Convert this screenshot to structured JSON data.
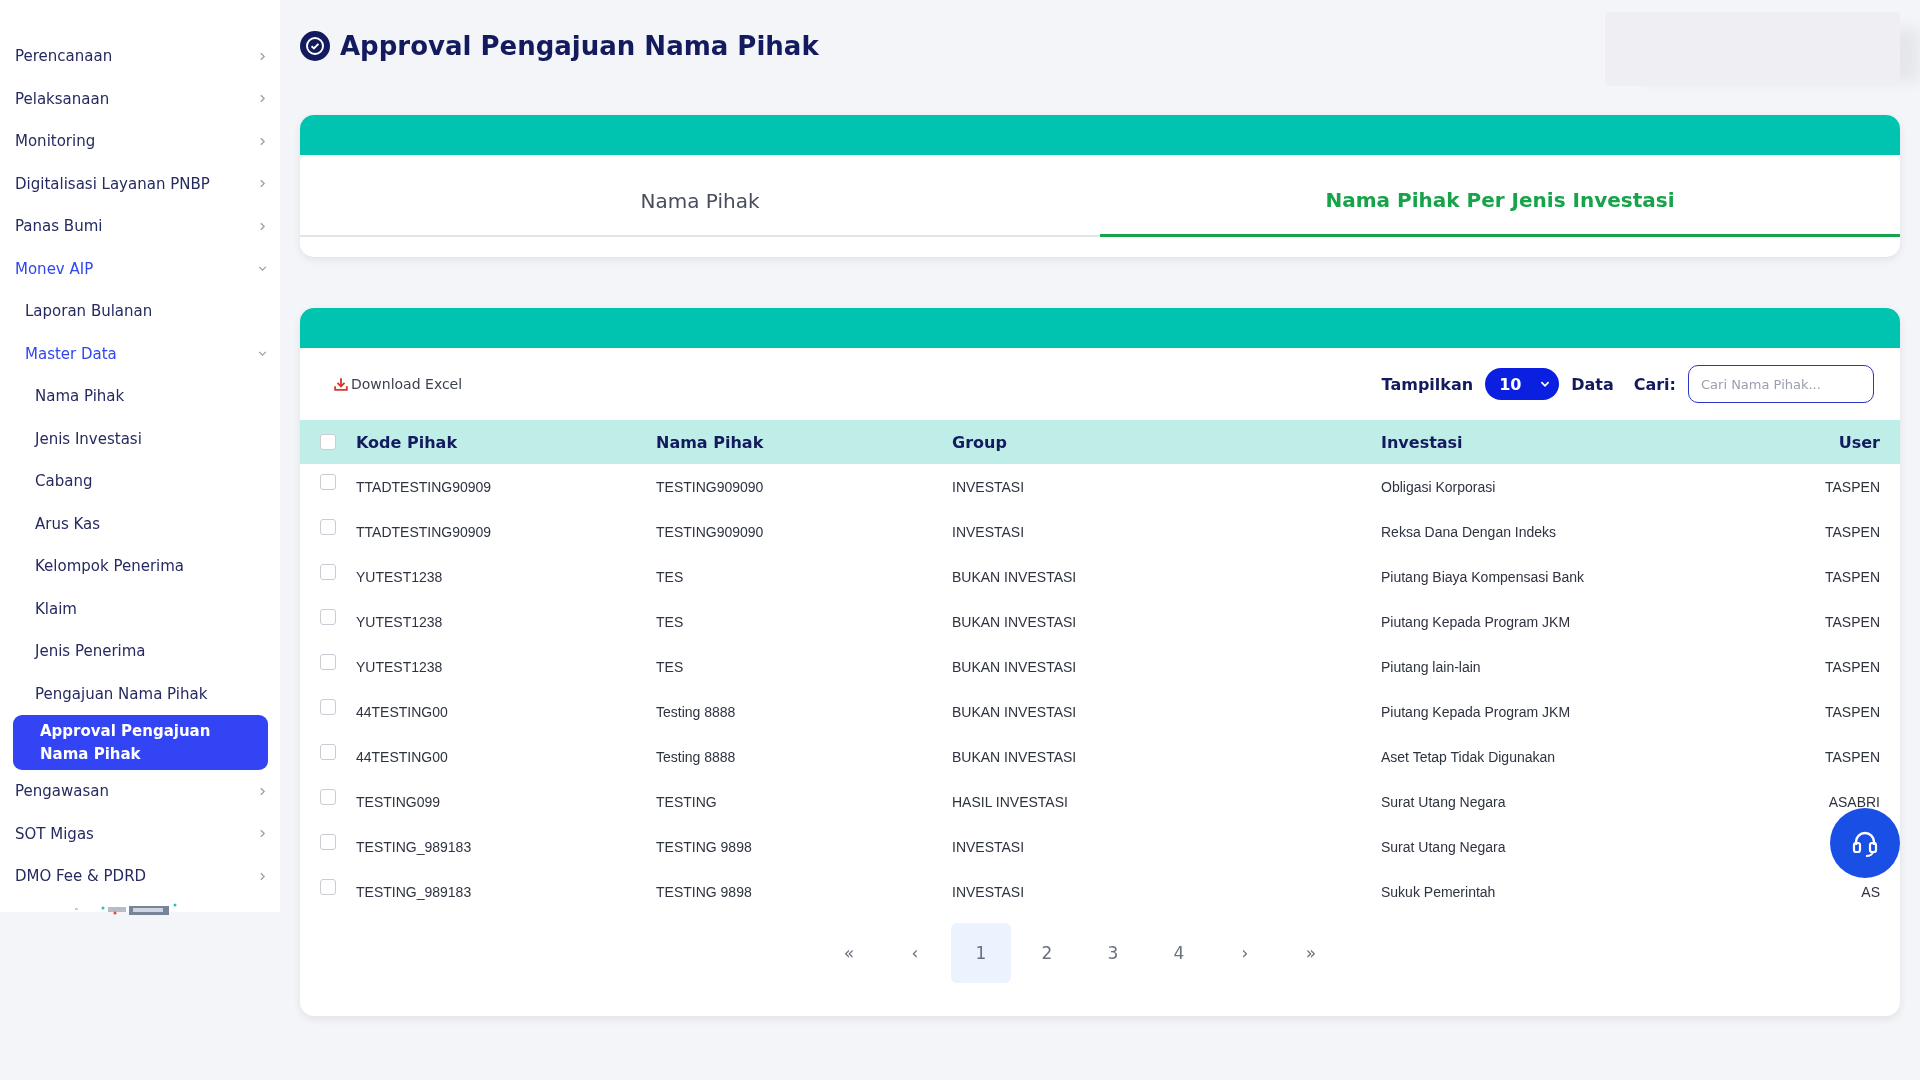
{
  "sidebar": {
    "items": [
      {
        "label": "Perencanaan",
        "expanded": false,
        "selected": false
      },
      {
        "label": "Pelaksanaan",
        "expanded": false,
        "selected": false
      },
      {
        "label": "Monitoring",
        "expanded": false,
        "selected": false
      },
      {
        "label": "Digitalisasi Layanan PNBP",
        "expanded": false,
        "selected": false
      },
      {
        "label": "Panas Bumi",
        "expanded": false,
        "selected": false
      },
      {
        "label": "Monev AIP",
        "expanded": true,
        "selected": false,
        "children": [
          {
            "label": "Laporan Bulanan",
            "selected": false
          },
          {
            "label": "Master Data",
            "expanded": true,
            "selected": false,
            "children": [
              {
                "label": "Nama Pihak",
                "selected": false
              },
              {
                "label": "Jenis Investasi",
                "selected": false
              },
              {
                "label": "Cabang",
                "selected": false
              },
              {
                "label": "Arus Kas",
                "selected": false
              },
              {
                "label": "Kelompok Penerima",
                "selected": false
              },
              {
                "label": "Klaim",
                "selected": false
              },
              {
                "label": "Jenis Penerima",
                "selected": false
              },
              {
                "label": "Pengajuan Nama Pihak",
                "selected": false
              },
              {
                "label": "Approval Pengajuan Nama Pihak",
                "selected": true
              }
            ]
          }
        ]
      },
      {
        "label": "Pengawasan",
        "expanded": false,
        "selected": false
      },
      {
        "label": "SOT Migas",
        "expanded": false,
        "selected": false
      },
      {
        "label": "DMO Fee & PDRD",
        "expanded": false,
        "selected": false
      }
    ]
  },
  "page": {
    "title": "Approval Pengajuan Nama Pihak"
  },
  "tabs": [
    {
      "label": "Nama Pihak",
      "selected": false
    },
    {
      "label": "Nama Pihak Per Jenis Investasi",
      "selected": true
    }
  ],
  "toolbar": {
    "download": "Download Excel",
    "show_label": "Tampilkan",
    "page_size": "10",
    "data_label": "Data",
    "search_label": "Cari:",
    "search": {
      "placeholder": "Cari Nama Pihak..."
    }
  },
  "table": {
    "select_all": {
      "checked": false
    },
    "columns": [
      "Kode Pihak",
      "Nama Pihak",
      "Group",
      "Investasi",
      "User"
    ],
    "rows": [
      {
        "checked": false,
        "cells": [
          "TTADTESTING90909",
          "TESTING909090",
          "INVESTASI",
          "Obligasi Korporasi",
          "TASPEN"
        ]
      },
      {
        "checked": false,
        "cells": [
          "TTADTESTING90909",
          "TESTING909090",
          "INVESTASI",
          "Reksa Dana Dengan Indeks",
          "TASPEN"
        ]
      },
      {
        "checked": false,
        "cells": [
          "YUTEST1238",
          "TES",
          "BUKAN INVESTASI",
          "Piutang Biaya Kompensasi Bank",
          "TASPEN"
        ]
      },
      {
        "checked": false,
        "cells": [
          "YUTEST1238",
          "TES",
          "BUKAN INVESTASI",
          "Piutang Kepada Program JKM",
          "TASPEN"
        ]
      },
      {
        "checked": false,
        "cells": [
          "YUTEST1238",
          "TES",
          "BUKAN INVESTASI",
          "Piutang lain-lain",
          "TASPEN"
        ]
      },
      {
        "checked": false,
        "cells": [
          "44TESTING00",
          "Testing 8888",
          "BUKAN INVESTASI",
          "Piutang Kepada Program JKM",
          "TASPEN"
        ]
      },
      {
        "checked": false,
        "cells": [
          "44TESTING00",
          "Testing 8888",
          "BUKAN INVESTASI",
          "Aset Tetap Tidak Digunakan",
          "TASPEN"
        ]
      },
      {
        "checked": false,
        "cells": [
          "TESTING099",
          "TESTING",
          "HASIL INVESTASI",
          "Surat Utang Negara",
          "ASABRI"
        ]
      },
      {
        "checked": false,
        "cells": [
          "TESTING_989183",
          "TESTING 9898",
          "INVESTASI",
          "Surat Utang Negara"
        ]
      },
      {
        "checked": false,
        "cells": [
          "TESTING_989183",
          "TESTING 9898",
          "INVESTASI",
          "Sukuk Pemerintah",
          "AS"
        ]
      }
    ]
  },
  "pagination": [
    {
      "label": "«",
      "selected": false
    },
    {
      "label": "‹",
      "selected": false
    },
    {
      "label": "1",
      "selected": true
    },
    {
      "label": "2",
      "selected": false
    },
    {
      "label": "3",
      "selected": false
    },
    {
      "label": "4",
      "selected": false
    },
    {
      "label": "›",
      "selected": false
    },
    {
      "label": "»",
      "selected": false
    }
  ]
}
